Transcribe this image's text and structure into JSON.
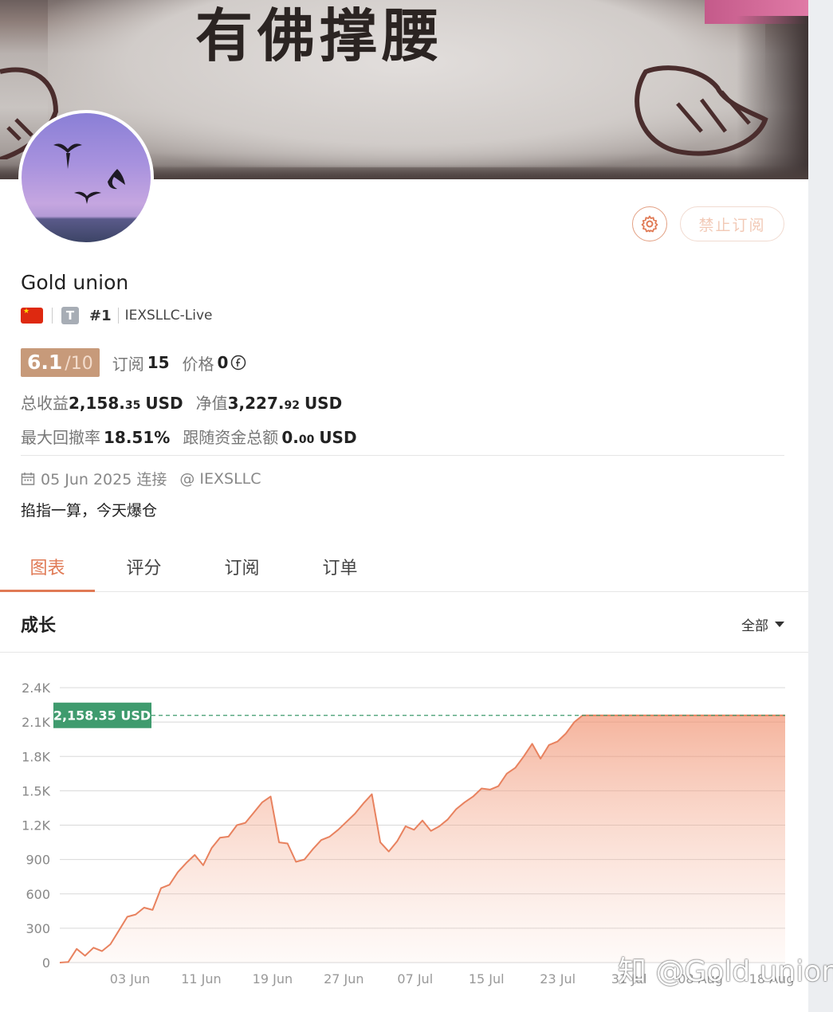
{
  "banner": {
    "text": "有佛撑腰"
  },
  "profile": {
    "name": "Gold union",
    "type_badge": "T",
    "rank": "#1",
    "server": "IEXSLLC-Live",
    "rating_score": "6.1",
    "rating_scale": "/10",
    "subscribe_button": "禁止订阅"
  },
  "stats": {
    "subscriptions_label": "订阅",
    "subscriptions_value": "15",
    "price_label": "价格",
    "price_value": "0",
    "price_icon": "coin-icon",
    "total_profit_label": "总收益",
    "total_profit_int": "2,158.",
    "total_profit_dec": "35",
    "total_profit_unit": "USD",
    "equity_label": "净值",
    "equity_int": "3,227.",
    "equity_dec": "92",
    "equity_unit": "USD",
    "max_drawdown_label": "最大回撤率",
    "max_drawdown_value": "18.51%",
    "follower_funds_label": "跟随资金总额",
    "follower_funds_int": "0.",
    "follower_funds_dec": "00",
    "follower_funds_unit": "USD"
  },
  "connection": {
    "date": "05 Jun 2025 连接",
    "broker": "@ IEXSLLC"
  },
  "bio": "掐指一算，今天爆仓",
  "tabs": [
    {
      "label": "图表",
      "active": true
    },
    {
      "label": "评分",
      "active": false
    },
    {
      "label": "订阅",
      "active": false
    },
    {
      "label": "订单",
      "active": false
    }
  ],
  "chart_section": {
    "title": "成长",
    "range": "全部"
  },
  "colors": {
    "accent": "#e07a55",
    "line": "#e8825f",
    "current_tag": "#3f9b6e"
  },
  "chart_data": {
    "type": "area",
    "title": "",
    "xlabel": "",
    "ylabel": "",
    "ylim": [
      0,
      2400
    ],
    "y_ticks": [
      "0",
      "300",
      "600",
      "900",
      "1.2K",
      "1.5K",
      "1.8K",
      "2.1K",
      "2.4K"
    ],
    "x_ticks": [
      "03 Jun",
      "11 Jun",
      "19 Jun",
      "27 Jun",
      "07 Jul",
      "15 Jul",
      "23 Jul",
      "31 Jul",
      "08 Aug",
      "18 Aug"
    ],
    "current_value_label": "2,158.35 USD",
    "current_value": 2158.35,
    "series": [
      {
        "x": [
          "27 May",
          "28 May",
          "29 May",
          "30 May",
          "31 May",
          "01 Jun",
          "02 Jun",
          "03 Jun",
          "04 Jun",
          "05 Jun",
          "06 Jun",
          "07 Jun",
          "08 Jun",
          "09 Jun",
          "10 Jun",
          "11 Jun",
          "12 Jun",
          "13 Jun",
          "14 Jun",
          "15 Jun",
          "16 Jun",
          "17 Jun",
          "18 Jun",
          "19 Jun",
          "20 Jun",
          "21 Jun",
          "22 Jun",
          "23 Jun",
          "24 Jun",
          "25 Jun",
          "26 Jun",
          "27 Jun",
          "28 Jun",
          "29 Jun",
          "30 Jun",
          "01 Jul",
          "02 Jul",
          "03 Jul",
          "04 Jul",
          "05 Jul",
          "06 Jul",
          "07 Jul",
          "08 Jul",
          "09 Jul",
          "10 Jul",
          "11 Jul",
          "12 Jul",
          "13 Jul",
          "14 Jul",
          "15 Jul",
          "16 Jul",
          "17 Jul",
          "18 Jul",
          "19 Jul",
          "20 Jul",
          "21 Jul",
          "22 Jul",
          "23 Jul",
          "24 Jul",
          "25 Jul",
          "26 Jul",
          "27 Jul",
          "28 Jul",
          "29 Jul",
          "30 Jul",
          "31 Jul",
          "01 Aug",
          "02 Aug",
          "03 Aug",
          "04 Aug",
          "05 Aug",
          "06 Aug",
          "07 Aug",
          "08 Aug",
          "09 Aug",
          "10 Aug",
          "11 Aug",
          "12 Aug",
          "13 Aug",
          "14 Aug",
          "15 Aug",
          "16 Aug",
          "17 Aug",
          "18 Aug",
          "19 Aug",
          "20 Aug",
          "21 Aug"
        ],
        "values": [
          0,
          5,
          120,
          60,
          130,
          100,
          160,
          280,
          400,
          420,
          480,
          460,
          650,
          680,
          790,
          870,
          940,
          850,
          1000,
          1090,
          1100,
          1200,
          1220,
          1310,
          1400,
          1450,
          1050,
          1040,
          880,
          900,
          990,
          1070,
          1100,
          1160,
          1230,
          1300,
          1390,
          1470,
          1050,
          970,
          1060,
          1190,
          1160,
          1240,
          1150,
          1190,
          1250,
          1340,
          1400,
          1450,
          1520,
          1510,
          1540,
          1650,
          1700,
          1800,
          1910,
          1780,
          1900,
          1930,
          2000,
          2100,
          2158.35,
          2158.35,
          2158.35,
          2158.35,
          2158.35,
          2158.35,
          2158.35,
          2158.35,
          2158.35,
          2158.35,
          2158.35,
          2158.35,
          2158.35,
          2158.35,
          2158.35,
          2158.35,
          2158.35,
          2158.35,
          2158.35,
          2158.35,
          2158.35,
          2158.35,
          2158.35,
          2158.35,
          2158.35
        ]
      }
    ]
  },
  "watermark": "知 @Gold union"
}
